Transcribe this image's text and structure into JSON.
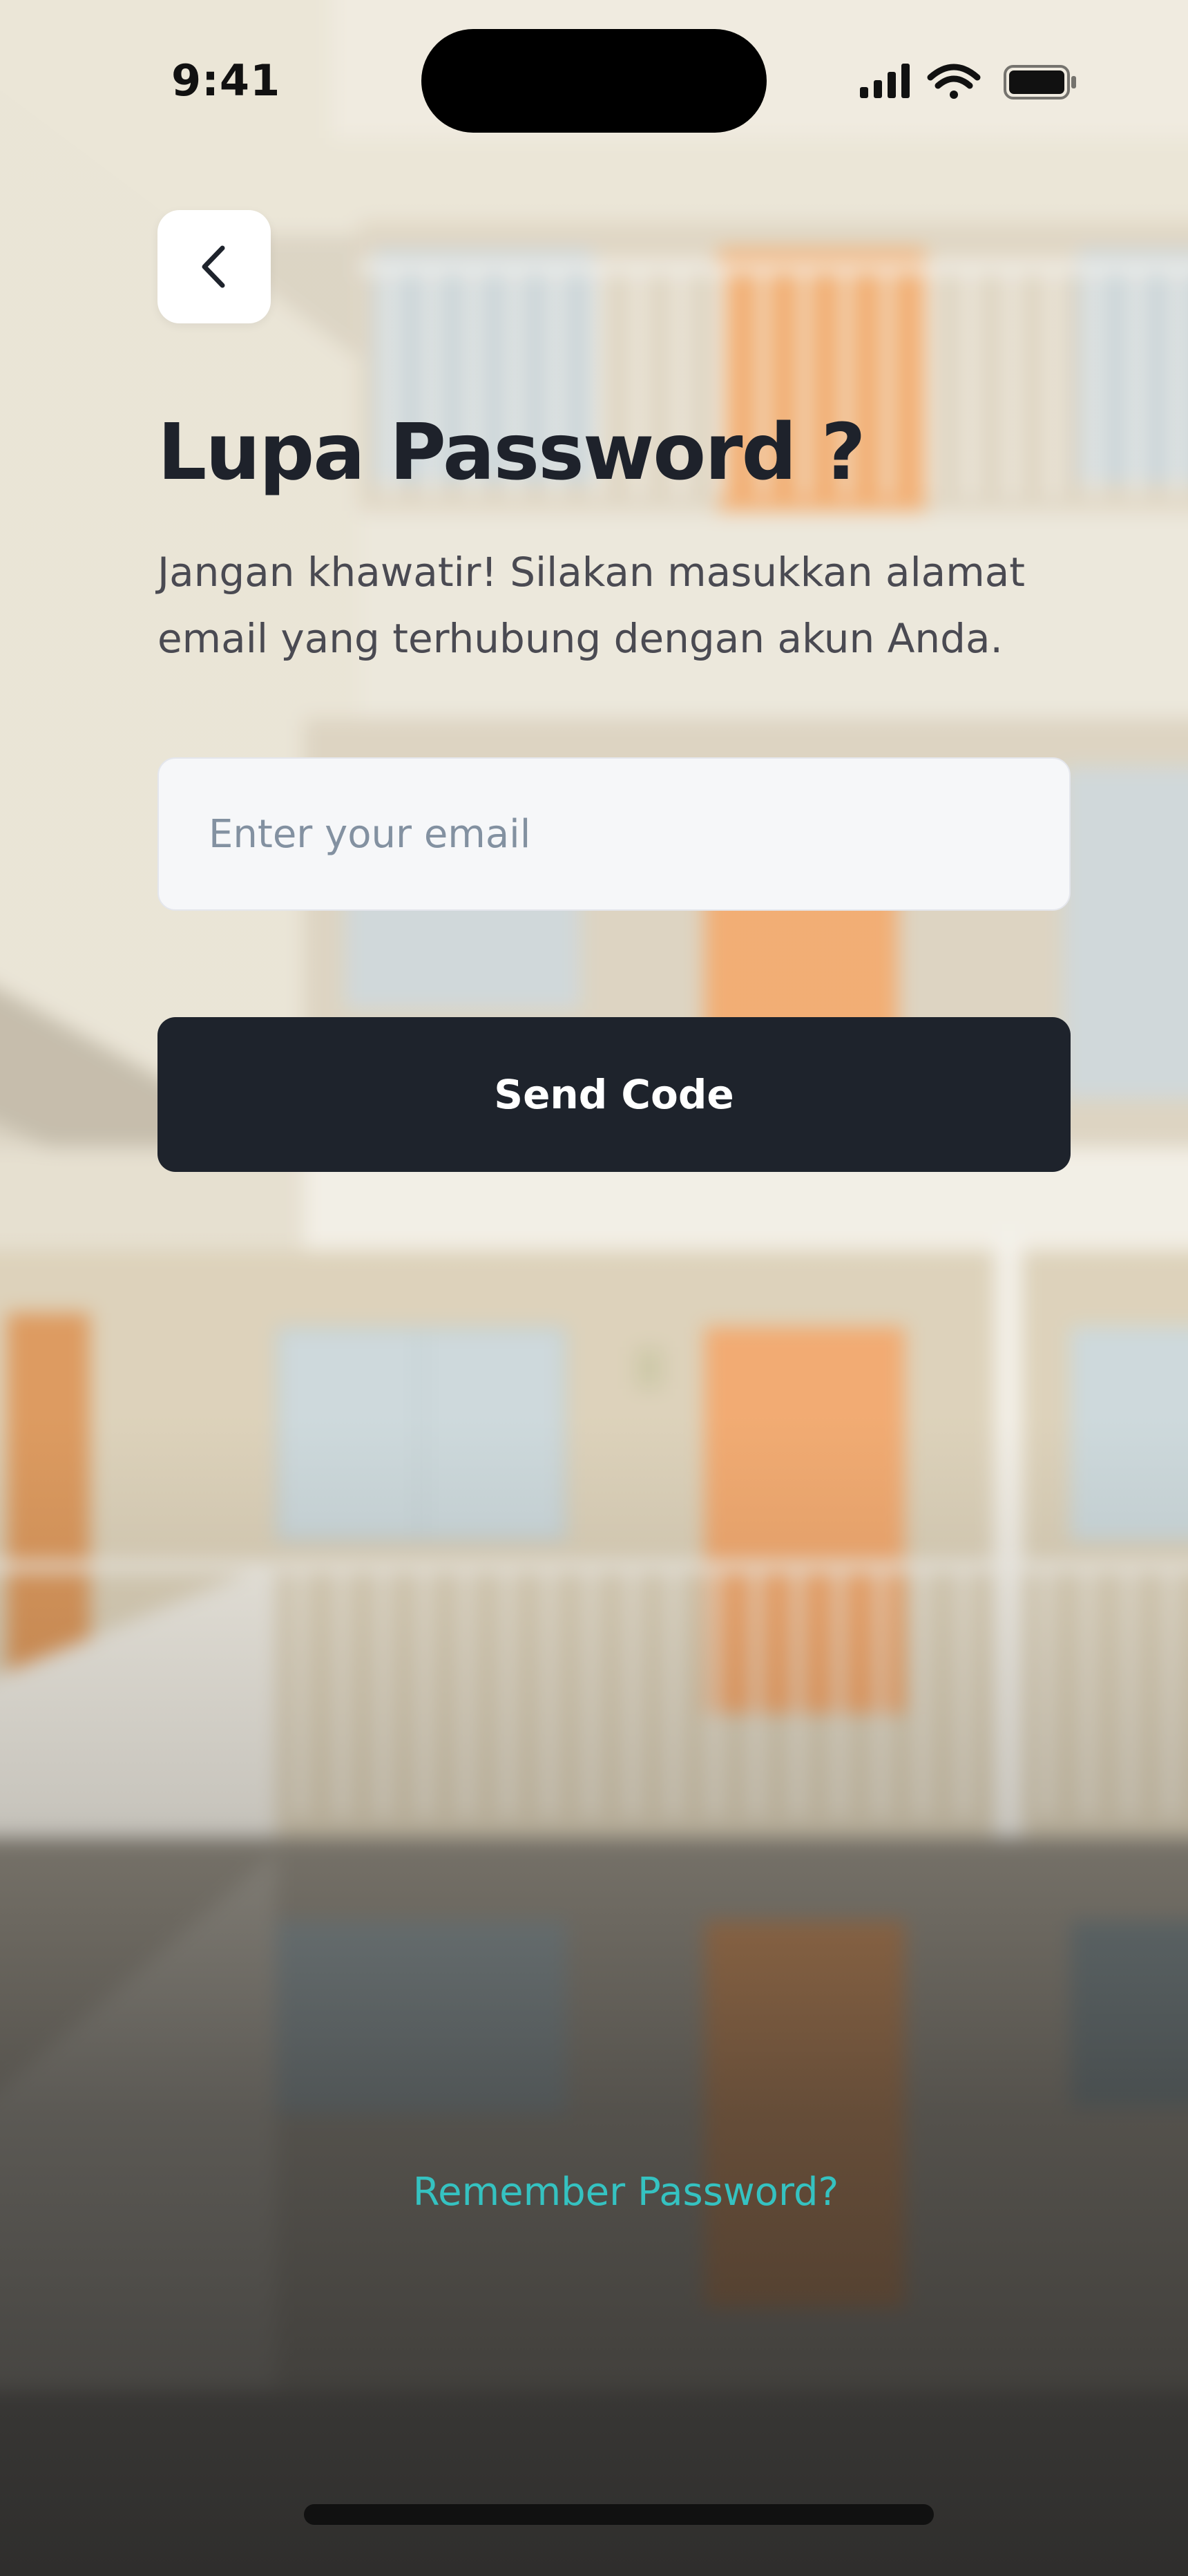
{
  "status_bar": {
    "time": "9:41",
    "icons": [
      "signal-icon",
      "wifi-icon",
      "battery-icon"
    ]
  },
  "back_button": {
    "icon": "chevron-left-icon"
  },
  "page": {
    "title": "Lupa Password ?",
    "subtitle": "Jangan khawatir! Silakan masukkan alamat email yang terhubung dengan akun Anda."
  },
  "form": {
    "email_placeholder": "Enter your email",
    "email_value": "",
    "send_label": "Send Code"
  },
  "footer": {
    "remember_link": "Remember Password?"
  },
  "colors": {
    "primary_dark": "#1e232c",
    "accent_teal": "#35c2c1",
    "input_bg": "#f6f7f9",
    "placeholder": "#8391a1"
  }
}
